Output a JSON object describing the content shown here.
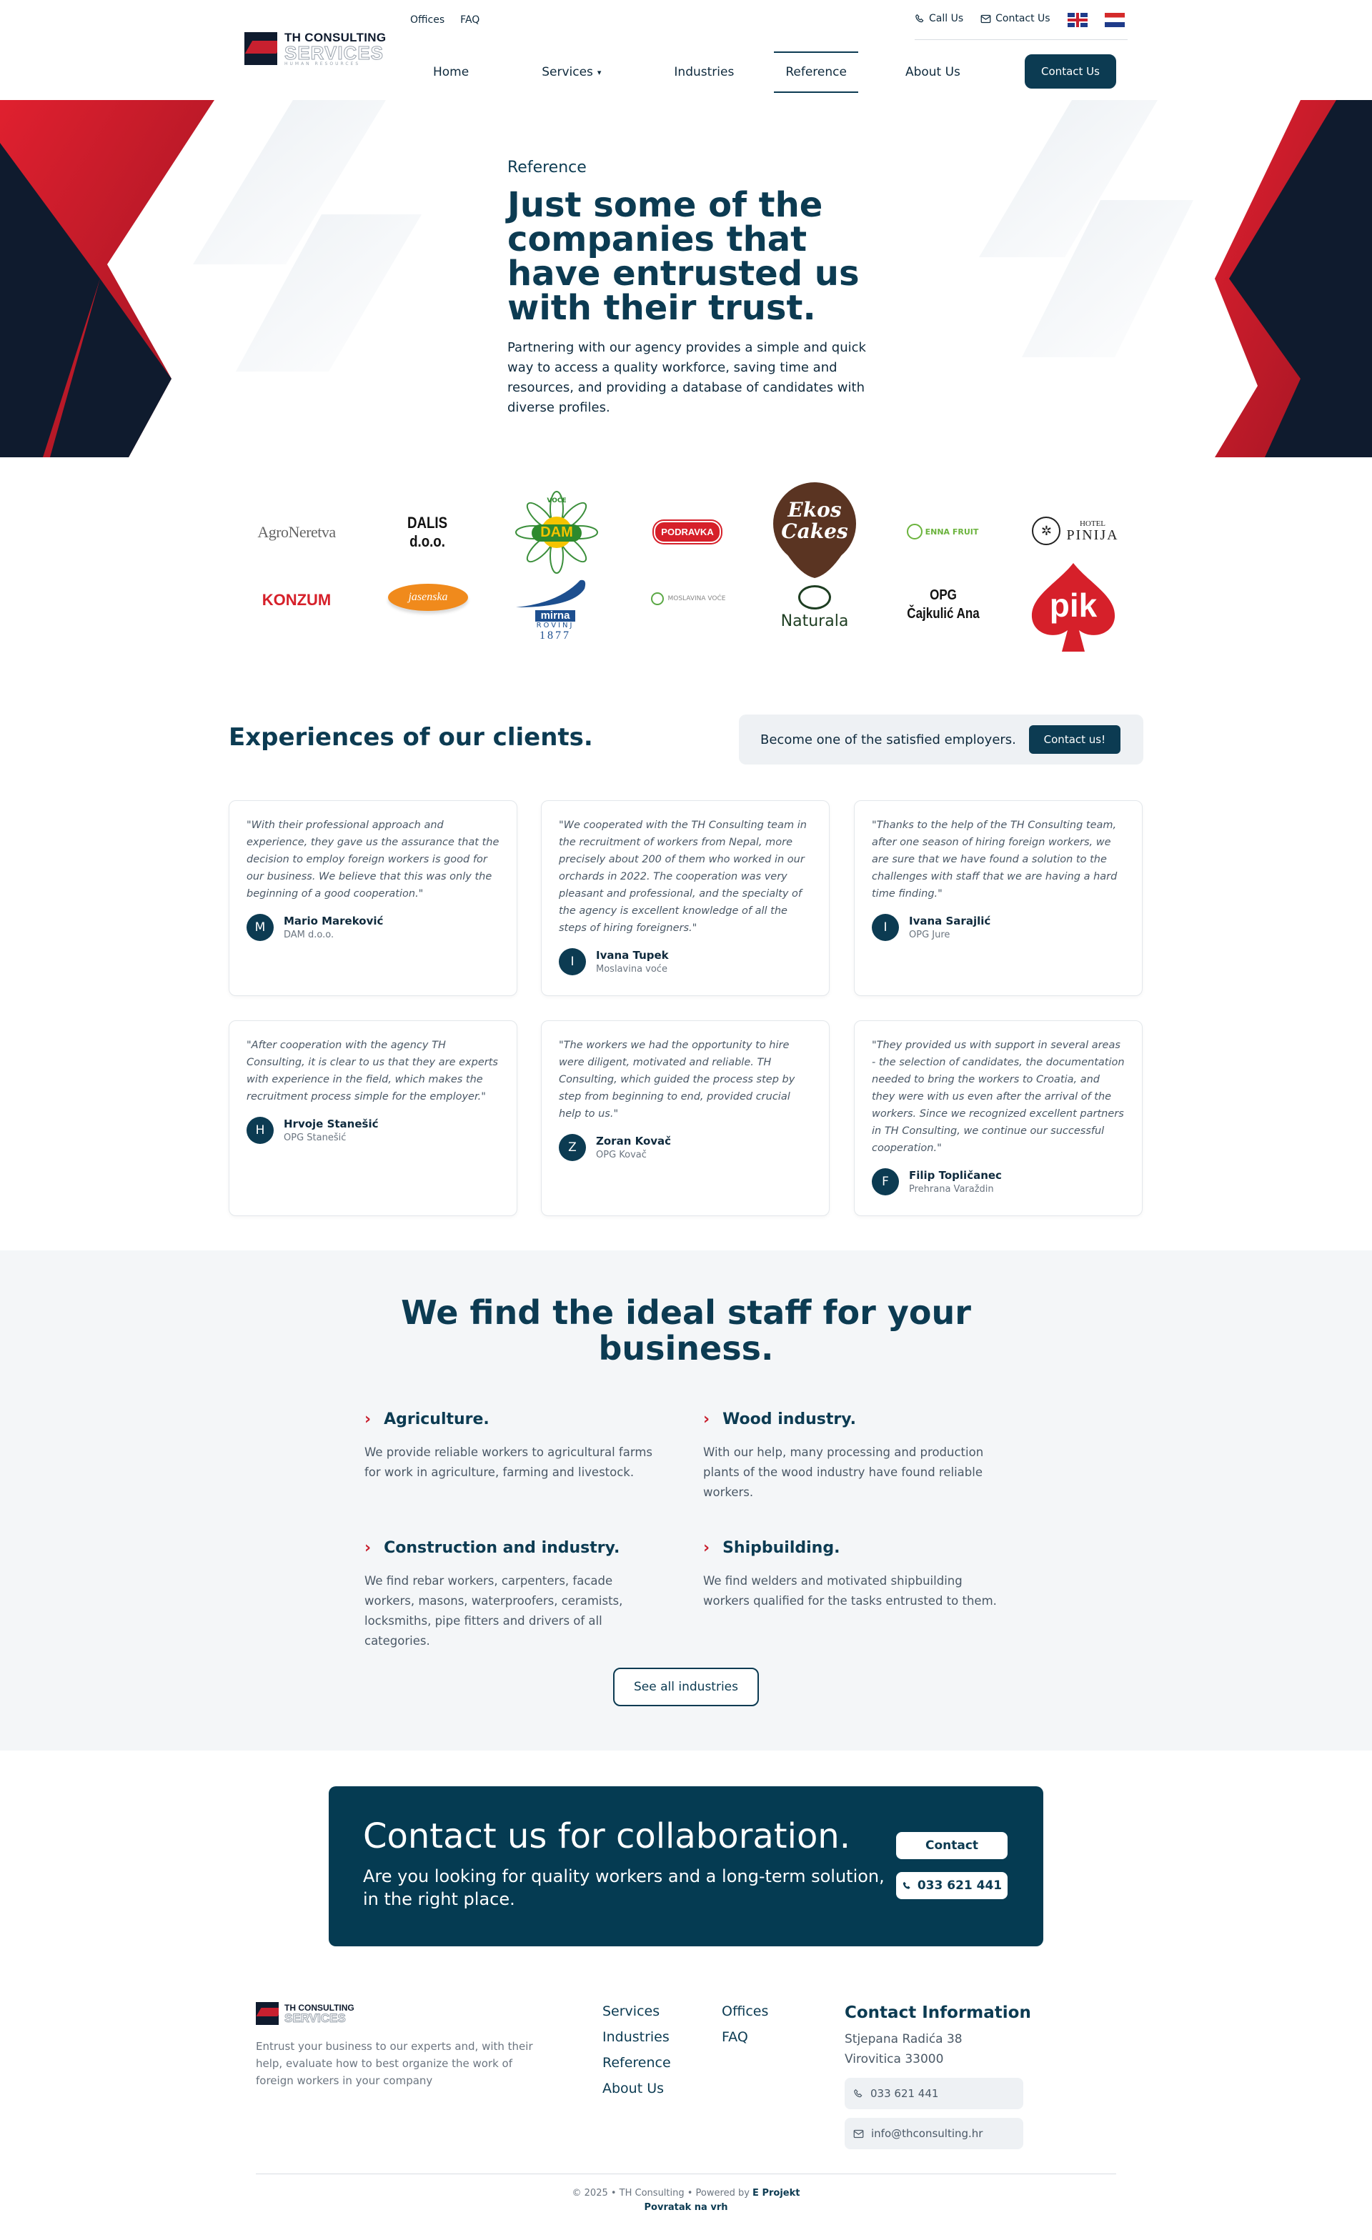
{
  "header": {
    "logo": {
      "line1": "TH CONSULTING",
      "line2": "SERVICES",
      "line3": "HUMAN RESOURCES"
    },
    "top_links": [
      "Offices",
      "FAQ"
    ],
    "call_us": "Call Us",
    "contact_us": "Contact Us",
    "nav": [
      "Home",
      "Services",
      "Industries",
      "Reference",
      "About Us"
    ],
    "nav_button": "Contact Us",
    "active_nav": "Reference"
  },
  "hero": {
    "kicker": "Reference",
    "title": "Just some of the companies that have entrusted us with their trust.",
    "description": "Partnering with our agency provides a simple and quick way to access a quality workforce, saving time and resources, and providing a database of candidates with diverse profiles."
  },
  "logos": {
    "agro": "AgroNeretva",
    "dalis": "DALIS d.o.o.",
    "dam": "DAM",
    "dam_top": "VOĆE",
    "podravka": "PODRAVKA",
    "ekos": "Ekos Cakes",
    "enna": "ENNA FRUIT",
    "pinija_small": "HOTEL",
    "pinija": "PINIJA",
    "konzum": "KONZUM",
    "jasenska": "jasenska",
    "mirna": "mirna",
    "mirna_sub": "ROVINJ",
    "mirna_year": "1877",
    "moslavina": "MOSLAVINA VOĆE",
    "naturala": "Naturala",
    "opg": "OPG",
    "cajkulic": "Čajkulić Ana",
    "pik": "pik"
  },
  "experiences": {
    "title": "Experiences of our clients.",
    "cta_text": "Become one of the satisfied employers.",
    "cta_button": "Contact us!",
    "testimonials": [
      {
        "quote": "\"With their professional approach and experience, they gave us the assurance that the decision to employ foreign workers is good for our business. We believe that this was only the beginning of a good cooperation.\"",
        "initial": "M",
        "name": "Mario Mareković",
        "company": "DAM d.o.o."
      },
      {
        "quote": "\"We cooperated with the TH Consulting team in the recruitment of workers from Nepal, more precisely about 200 of them who worked in our orchards in 2022. The cooperation was very pleasant and professional, and the specialty of the agency is excellent knowledge of all the steps of hiring foreigners.\"",
        "initial": "I",
        "name": "Ivana Tupek",
        "company": "Moslavina voće"
      },
      {
        "quote": "\"Thanks to the help of the TH Consulting team, after one season of hiring foreign workers, we are sure that we have found a solution to the challenges with staff that we are having a hard time finding.\"",
        "initial": "I",
        "name": "Ivana Sarajlić",
        "company": "OPG Jure"
      },
      {
        "quote": "\"After cooperation with the agency TH Consulting, it is clear to us that they are experts with experience in the field, which makes the recruitment process simple for the employer.\"",
        "initial": "H",
        "name": "Hrvoje Stanešić",
        "company": "OPG Stanešić"
      },
      {
        "quote": "\"The workers we had the opportunity to hire were diligent, motivated and reliable. TH Consulting, which guided the process step by step from beginning to end, provided crucial help to us.\"",
        "initial": "Z",
        "name": "Zoran Kovač",
        "company": "OPG Kovač"
      },
      {
        "quote": "\"They provided us with support in several areas - the selection of candidates, the documentation needed to bring the workers to Croatia, and they were with us even after the arrival of the workers. Since we recognized excellent partners in TH Consulting, we continue our successful cooperation.\"",
        "initial": "F",
        "name": "Filip Topličanec",
        "company": "Prehrana Varaždin"
      }
    ]
  },
  "staff": {
    "title": "We find the ideal staff for your business.",
    "industries": [
      {
        "title": "Agriculture.",
        "text": "We provide reliable workers to agricultural farms for work in agriculture, farming and livestock."
      },
      {
        "title": "Wood industry.",
        "text": "With our help, many processing and production plants of the wood industry have found reliable workers."
      },
      {
        "title": "Construction and industry.",
        "text": "We find rebar workers, carpenters, facade workers, masons, waterproofers, ceramists, locksmiths, pipe fitters and drivers of all categories."
      },
      {
        "title": "Shipbuilding.",
        "text": "We find welders and motivated shipbuilding workers qualified for the tasks entrusted to them."
      }
    ],
    "button": "See all industries"
  },
  "collab": {
    "title": "Contact us for collaboration.",
    "text": "Are you looking for quality workers and a long-term solution, in the right place.",
    "contact_button": "Contact",
    "phone_button": "033 621 441"
  },
  "footer": {
    "description": "Entrust your business to our experts and, with their help, evaluate how to best organize the work of foreign workers in your company",
    "col1": [
      "Services",
      "Industries",
      "Reference",
      "About Us"
    ],
    "col2": [
      "Offices",
      "FAQ"
    ],
    "contact_title": "Contact Information",
    "address_line1": "Stjepana Radića 38",
    "address_line2": "Virovitica 33000",
    "phone": "033 621 441",
    "email": "info@thconsulting.hr",
    "copyright": "© 2025 • TH Consulting • Powered by",
    "powered": "E Projekt",
    "back_to_top": "Povratak na vrh"
  }
}
